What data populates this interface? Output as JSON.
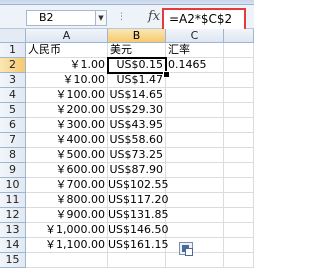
{
  "name_box": "B2",
  "formula": "=A2*$C$2",
  "fx_label": "fx",
  "columns": [
    "A",
    "B",
    "C"
  ],
  "rows": [
    {
      "n": "1",
      "a": "人民币",
      "b": "美元",
      "c": "汇率"
    },
    {
      "n": "2",
      "a": "￥1.00",
      "b": "US$0.15",
      "c": "0.1465"
    },
    {
      "n": "3",
      "a": "￥10.00",
      "b": "US$1.47",
      "c": ""
    },
    {
      "n": "4",
      "a": "￥100.00",
      "b": "US$14.65",
      "c": ""
    },
    {
      "n": "5",
      "a": "￥200.00",
      "b": "US$29.30",
      "c": ""
    },
    {
      "n": "6",
      "a": "￥300.00",
      "b": "US$43.95",
      "c": ""
    },
    {
      "n": "7",
      "a": "￥400.00",
      "b": "US$58.60",
      "c": ""
    },
    {
      "n": "8",
      "a": "￥500.00",
      "b": "US$73.25",
      "c": ""
    },
    {
      "n": "9",
      "a": "￥600.00",
      "b": "US$87.90",
      "c": ""
    },
    {
      "n": "10",
      "a": "￥700.00",
      "b": "US$102.55",
      "c": ""
    },
    {
      "n": "11",
      "a": "￥800.00",
      "b": "US$117.20",
      "c": ""
    },
    {
      "n": "12",
      "a": "￥900.00",
      "b": "US$131.85",
      "c": ""
    },
    {
      "n": "13",
      "a": "￥1,000.00",
      "b": "US$146.50",
      "c": ""
    },
    {
      "n": "14",
      "a": "￥1,100.00",
      "b": "US$161.15",
      "c": ""
    },
    {
      "n": "15",
      "a": "",
      "b": "",
      "c": ""
    }
  ],
  "icons": {
    "namebox_dropdown": "chevron-down-icon",
    "paste_options": "paste-options-icon"
  },
  "colors": {
    "highlight_border": "#e33b3b",
    "selected_header": "#f7c96d"
  }
}
